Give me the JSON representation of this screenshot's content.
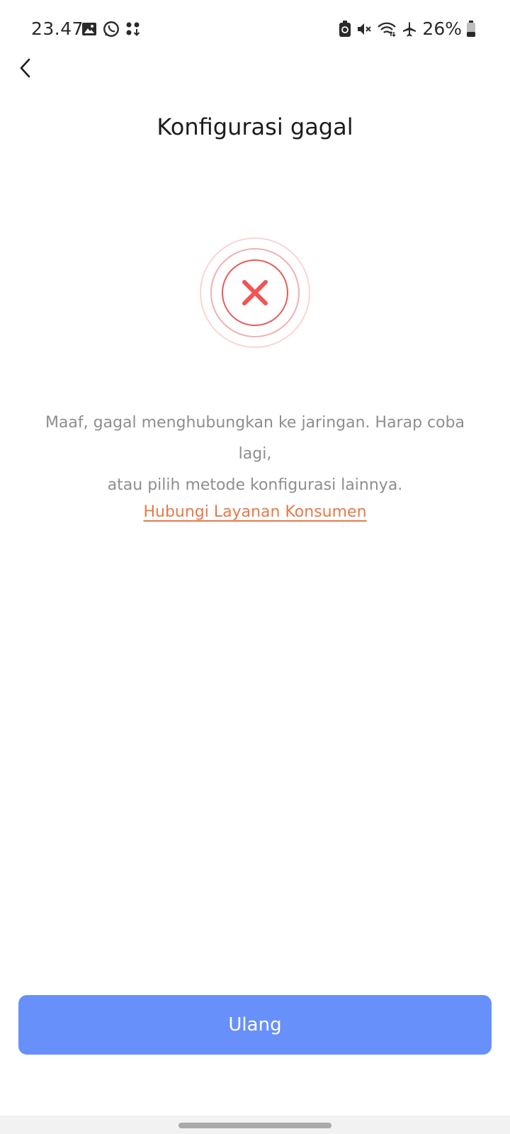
{
  "status_bar": {
    "time": "23.47",
    "battery": "26%",
    "left_icons": [
      "image-icon",
      "whatsapp-icon",
      "app-download-icon"
    ],
    "right_icons": [
      "battery-saver-icon",
      "mute-icon",
      "wifi-icon",
      "airplane-icon",
      "battery-icon"
    ]
  },
  "header": {
    "back_icon": "chevron-left-icon",
    "title": "Konfigurasi gagal"
  },
  "status": {
    "icon": "error-x-icon",
    "icon_color": "#f05454",
    "message_line1": "Maaf, gagal menghubungkan ke jaringan. Harap coba lagi,",
    "message_line2": "atau pilih metode konfigurasi lainnya.",
    "support_link": "Hubungi Layanan Konsumen",
    "link_color": "#e47a4a"
  },
  "actions": {
    "retry_label": "Ulang",
    "button_color": "#6890fa"
  }
}
